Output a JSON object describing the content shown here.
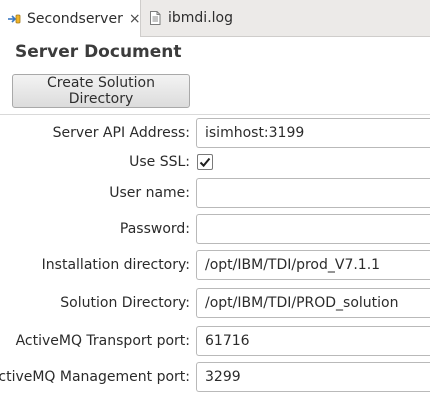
{
  "tabs": [
    {
      "label": "Secondserver",
      "icon": "server-document-icon",
      "active": true,
      "close": "×"
    },
    {
      "label": "ibmdi.log",
      "icon": "log-file-icon",
      "active": false
    }
  ],
  "page": {
    "title": "Server Document",
    "create_button": "Create Solution Directory"
  },
  "fields": {
    "api_address": {
      "label": "Server API Address:",
      "value": "isimhost:3199"
    },
    "use_ssl": {
      "label": "Use SSL:",
      "checked": true
    },
    "user_name": {
      "label": "User name:",
      "value": ""
    },
    "password": {
      "label": "Password:",
      "value": ""
    },
    "install_dir": {
      "label": "Installation directory:",
      "value": "/opt/IBM/TDI/prod_V7.1.1"
    },
    "solution_dir": {
      "label": "Solution Directory:",
      "value": "/opt/IBM/TDI/PROD_solution"
    },
    "transport_port": {
      "label": "ActiveMQ Transport port:",
      "value": "61716"
    },
    "management_port": {
      "label": "ActiveMQ Management port:",
      "value": "3299"
    }
  },
  "colors": {
    "tab_bar": "#eceae8",
    "server_icon": "#3a78c2",
    "text": "#2b2b2b"
  }
}
